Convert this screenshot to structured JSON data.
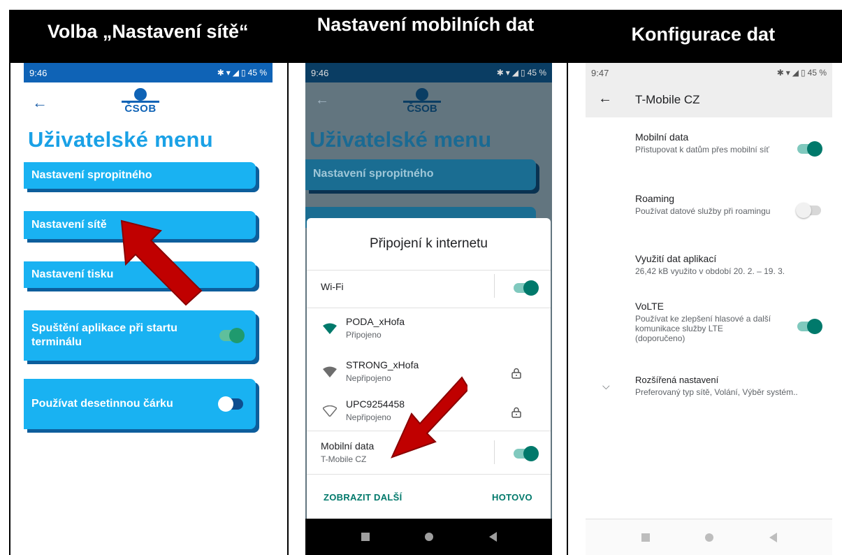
{
  "headers": [
    "Volba „Nastavení sítě“",
    "Nastavení mobilních dat",
    "Konfigurace dat"
  ],
  "colors": {
    "csob_blue": "#0f63b6",
    "menu_title": "#1aa1e6",
    "menu_button": "#19b2f2",
    "menu_button_shadow": "#0d5e9c",
    "toggle_teal": "#00796b",
    "arrow_red": "#c00000"
  },
  "screen1": {
    "status_time": "9:46",
    "status_battery": "45 %",
    "back_icon": "arrow-left-icon",
    "logo_text": "ČSOB",
    "title": "Uživatelské menu",
    "buttons": [
      {
        "label": "Nastavení spropitného"
      },
      {
        "label": "Nastavení sítě"
      },
      {
        "label": "Nastavení tisku"
      },
      {
        "label": "Spuštění aplikace při startu terminálu",
        "toggle": true
      },
      {
        "label": "Používat desetinnou čárku",
        "toggle": false
      }
    ]
  },
  "screen2": {
    "status_time": "9:46",
    "status_battery": "45 %",
    "bg_logo_text": "ČSOB",
    "bg_title": "Uživatelské menu",
    "bg_button": "Nastavení spropitného",
    "dialog_title": "Připojení k internetu",
    "wifi_label": "Wi-Fi",
    "wifi_enabled": true,
    "networks": [
      {
        "ssid": "PODA_xHofa",
        "status": "Připojeno",
        "locked": false
      },
      {
        "ssid": "STRONG_xHofa",
        "status": "Nepřipojeno",
        "locked": true
      },
      {
        "ssid": "UPC9254458",
        "status": "Nepřipojeno",
        "locked": true
      }
    ],
    "mobile_data_label": "Mobilní data",
    "mobile_data_operator": "T-Mobile CZ",
    "mobile_data_enabled": true,
    "show_more_label": "ZOBRAZIT DALŠÍ",
    "done_label": "HOTOVO"
  },
  "screen3": {
    "status_time": "9:47",
    "status_battery": "45 %",
    "title": "T-Mobile CZ",
    "settings": [
      {
        "name": "Mobilní data",
        "summary": "Přistupovat k datům přes mobilní síť",
        "toggle": true
      },
      {
        "name": "Roaming",
        "summary": "Používat datové služby při roamingu",
        "toggle": false
      },
      {
        "name": "Využití dat aplikací",
        "summary": "26,42 kB využito v období 20. 2. – 19. 3."
      },
      {
        "name": "VoLTE",
        "summary": "Používat ke zlepšení hlasové a další komunikace služby LTE (doporučeno)",
        "toggle": true
      },
      {
        "name": "Rozšířená nastavení",
        "summary": "Preferovaný typ sítě, Volání, Výběr systém.."
      }
    ]
  }
}
